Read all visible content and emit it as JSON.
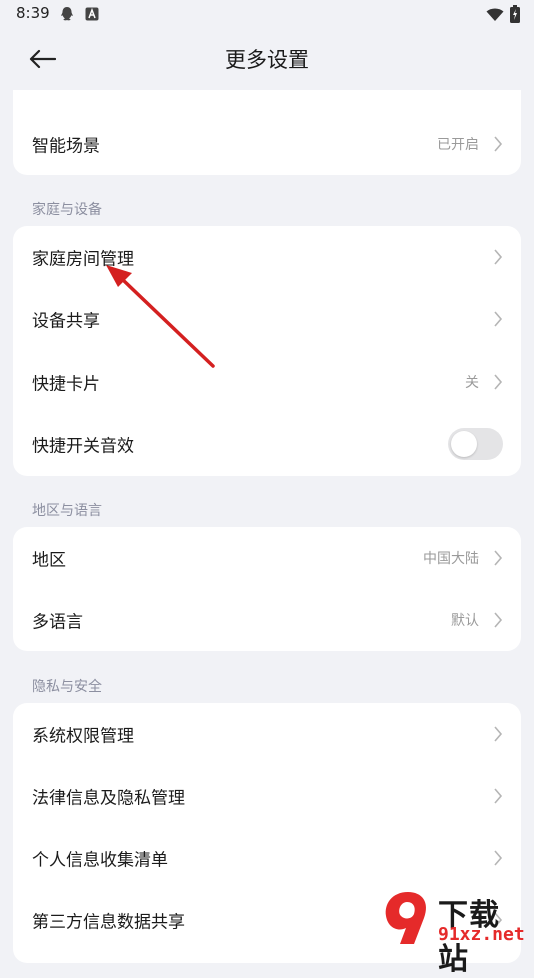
{
  "status_bar": {
    "time": "8:39"
  },
  "header": {
    "title": "更多设置"
  },
  "top_card": {
    "partial_label": "",
    "partial_value": "",
    "smart_scene": {
      "label": "智能场景",
      "value": "已开启"
    }
  },
  "sections": {
    "home": {
      "title": "家庭与设备",
      "items": [
        {
          "label": "家庭房间管理",
          "value": ""
        },
        {
          "label": "设备共享",
          "value": ""
        },
        {
          "label": "快捷卡片",
          "value": "关"
        },
        {
          "label": "快捷开关音效",
          "toggle": false
        }
      ]
    },
    "region": {
      "title": "地区与语言",
      "items": [
        {
          "label": "地区",
          "value": "中国大陆"
        },
        {
          "label": "多语言",
          "value": "默认"
        }
      ]
    },
    "privacy": {
      "title": "隐私与安全",
      "items": [
        {
          "label": "系统权限管理",
          "value": ""
        },
        {
          "label": "法律信息及隐私管理",
          "value": ""
        },
        {
          "label": "个人信息收集清单",
          "value": ""
        },
        {
          "label": "第三方信息数据共享",
          "value": ""
        }
      ]
    }
  },
  "watermark": {
    "text_top": "下载站",
    "text_bottom": "91xz.net"
  },
  "colors": {
    "annotation_arrow": "#d42020",
    "toggle_off": "#e4e4e6",
    "watermark_red": "#e52a2a"
  },
  "icons": [
    "back-arrow-icon",
    "chevron-right-icon",
    "qq-icon",
    "a-badge-icon",
    "wifi-icon",
    "battery-icon"
  ]
}
